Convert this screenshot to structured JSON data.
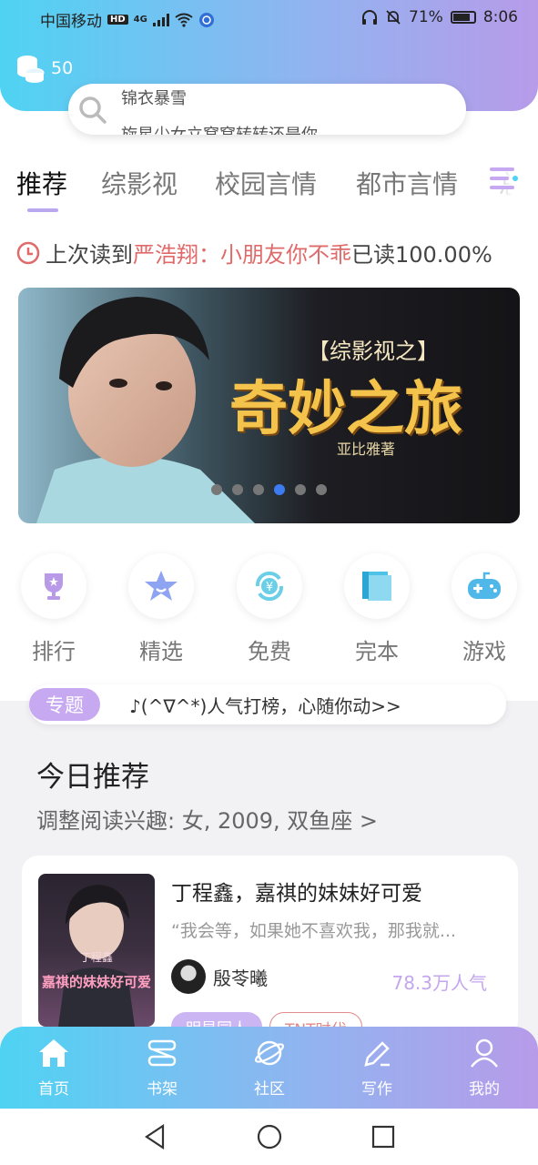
{
  "status_bar": {
    "carrier": "中国移动",
    "hd": "HD",
    "network": "4G",
    "battery": "71%",
    "time": "8:06"
  },
  "header": {
    "coins": "50",
    "search_line1": "锦衣暴雪",
    "search_line2": "旋星少女立窝窝转转还是你"
  },
  "tabs": [
    "推荐",
    "综影视",
    "校园言情",
    "都市言情",
    "总"
  ],
  "last_read": {
    "prefix": "上次读到",
    "title": "严浩翔：小朋友你不乖",
    "progress": "已读100.00%"
  },
  "banner": {
    "subtitle": "【综影视之】",
    "title": "奇妙之旅",
    "author": "亚比雅著",
    "active_index": 3,
    "count": 6
  },
  "quick_links": [
    {
      "label": "排行",
      "icon": "trophy-icon"
    },
    {
      "label": "精选",
      "icon": "star-icon"
    },
    {
      "label": "免费",
      "icon": "yuan-free-icon"
    },
    {
      "label": "完本",
      "icon": "book-icon"
    },
    {
      "label": "游戏",
      "icon": "gamepad-icon"
    }
  ],
  "topic": {
    "tag": "专题",
    "text": "♪(^∇^*)人气打榜，心随你动>>"
  },
  "today": {
    "title": "今日推荐",
    "subtitle": "调整阅读兴趣: 女, 2009, 双鱼座 >"
  },
  "book": {
    "cover_text": "嘉祺的妹妹好可爱",
    "cover_name": "丁程鑫",
    "title": "丁程鑫，嘉祺的妹妹好可爱",
    "quote": "“我会等，如果她不喜欢我，那我就...",
    "author": "殷苓曦",
    "popularity": "78.3万人气",
    "tags": [
      "明星同人",
      "TNT时代"
    ]
  },
  "bottom_nav": [
    {
      "label": "首页",
      "icon": "home-icon"
    },
    {
      "label": "书架",
      "icon": "bookshelf-icon"
    },
    {
      "label": "社区",
      "icon": "planet-icon"
    },
    {
      "label": "写作",
      "icon": "pen-icon"
    },
    {
      "label": "我的",
      "icon": "user-icon"
    }
  ],
  "colors": {
    "gradient_start": "#4fd3f3",
    "gradient_end": "#b79be9",
    "accent_purple": "#c7a9f1",
    "accent_red": "#e06a6a",
    "dot_active": "#3d7bf0"
  }
}
